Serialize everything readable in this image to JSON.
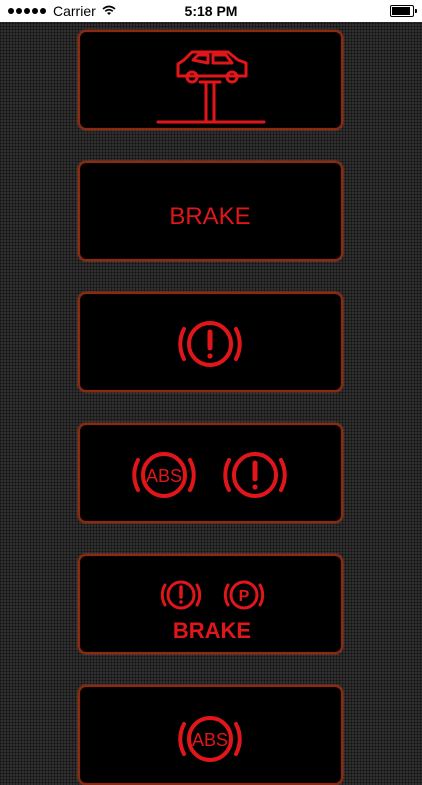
{
  "status_bar": {
    "carrier": "Carrier",
    "time": "5:18 PM",
    "battery_level": 1.0
  },
  "indicators": [
    {
      "icon": "vehicle-lift-icon"
    },
    {
      "label": "BRAKE"
    },
    {
      "icon": "brake-warning-icon"
    },
    {
      "icon": "abs-icon",
      "abs_label": "ABS",
      "icon2": "brake-warning-icon"
    },
    {
      "icon": "brake-warning-icon",
      "icon2": "parking-brake-icon",
      "p_label": "P",
      "label": "BRAKE"
    },
    {
      "icon": "abs-icon",
      "abs_label": "ABS"
    }
  ],
  "colors": {
    "indicator_red": "#e0161b",
    "card_border": "#8a2a10",
    "card_bg": "#000000"
  }
}
